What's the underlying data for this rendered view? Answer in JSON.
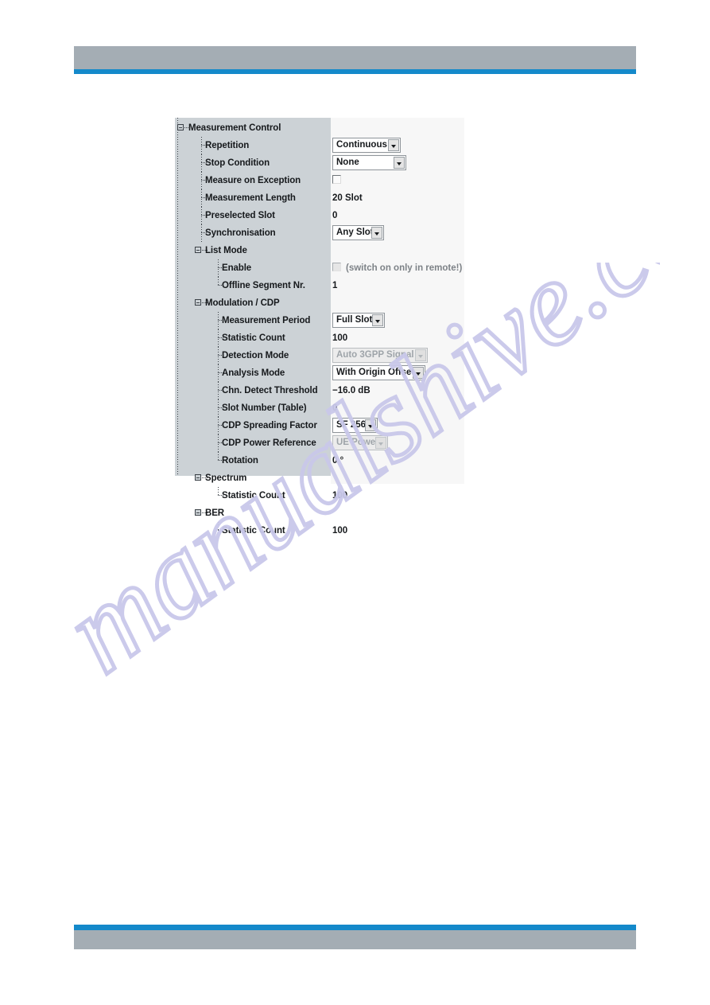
{
  "page": {
    "watermark_text": "manualshive.com",
    "accent_color": "#1489ca",
    "band_color": "#a4adb4",
    "tree_bg_color": "#ccd2d6",
    "value_bg_color": "#f7f7f7"
  },
  "dialog": {
    "title": "Measurement Control",
    "rows": [
      {
        "label": "Measurement Control",
        "depth": 0,
        "kind": "node",
        "expander": "collapse-box",
        "value_type": "none",
        "value": ""
      },
      {
        "label": "Repetition",
        "depth": 1,
        "kind": "leaf",
        "value_type": "combo",
        "value": "Continuous",
        "width": 86,
        "disabled": false
      },
      {
        "label": "Stop Condition",
        "depth": 1,
        "kind": "leaf",
        "value_type": "combo",
        "value": "None",
        "width": 93,
        "disabled": false
      },
      {
        "label": "Measure on Exception",
        "depth": 1,
        "kind": "leaf",
        "value_type": "checkbox",
        "value": "",
        "checked": false,
        "disabled": false
      },
      {
        "label": "Measurement Length",
        "depth": 1,
        "kind": "leaf",
        "value_type": "text",
        "value": "20 Slot"
      },
      {
        "label": "Preselected Slot",
        "depth": 1,
        "kind": "leaf",
        "value_type": "text",
        "value": "0"
      },
      {
        "label": "Synchronisation",
        "depth": 1,
        "kind": "leaf",
        "value_type": "combo",
        "value": "Any Slot",
        "width": 65,
        "disabled": false
      },
      {
        "label": "List Mode",
        "depth": 1,
        "kind": "node",
        "expander": "collapse-box",
        "value_type": "none",
        "value": ""
      },
      {
        "label": "Enable",
        "depth": 2,
        "kind": "leaf",
        "value_type": "checkbox-hint",
        "value": "",
        "hint": "(switch on only in remote!)",
        "checked": false,
        "disabled": true
      },
      {
        "label": "Offline Segment Nr.",
        "depth": 2,
        "kind": "leaf-last",
        "value_type": "text",
        "value": "1"
      },
      {
        "label": "Modulation / CDP",
        "depth": 1,
        "kind": "node",
        "expander": "collapse-box",
        "value_type": "none",
        "value": ""
      },
      {
        "label": "Measurement Period",
        "depth": 2,
        "kind": "leaf",
        "value_type": "combo",
        "value": "Full Slot",
        "width": 66,
        "disabled": false
      },
      {
        "label": "Statistic Count",
        "depth": 2,
        "kind": "leaf",
        "value_type": "text",
        "value": "100"
      },
      {
        "label": "Detection Mode",
        "depth": 2,
        "kind": "leaf",
        "value_type": "combo",
        "value": "Auto 3GPP Signal",
        "width": 120,
        "disabled": true
      },
      {
        "label": "Analysis Mode",
        "depth": 2,
        "kind": "leaf",
        "value_type": "combo",
        "value": "With Origin Offset",
        "width": 117,
        "disabled": false
      },
      {
        "label": "Chn. Detect Threshold",
        "depth": 2,
        "kind": "leaf",
        "value_type": "text",
        "value": "−16.0 dB"
      },
      {
        "label": "Slot Number (Table)",
        "depth": 2,
        "kind": "leaf",
        "value_type": "text",
        "value": "0"
      },
      {
        "label": "CDP Spreading Factor",
        "depth": 2,
        "kind": "leaf",
        "value_type": "combo",
        "value": "SF 256",
        "width": 57,
        "disabled": false
      },
      {
        "label": "CDP Power Reference",
        "depth": 2,
        "kind": "leaf",
        "value_type": "combo",
        "value": "UE Power",
        "width": 70,
        "disabled": true
      },
      {
        "label": "Rotation",
        "depth": 2,
        "kind": "leaf-last",
        "value_type": "text",
        "value": "0 °"
      },
      {
        "label": "Spectrum",
        "depth": 1,
        "kind": "node",
        "expander": "collapse-box",
        "value_type": "none",
        "value": ""
      },
      {
        "label": "Statistic Count",
        "depth": 2,
        "kind": "leaf-last",
        "value_type": "text",
        "value": "100"
      },
      {
        "label": "BER",
        "depth": 1,
        "kind": "node",
        "expander": "collapse-box",
        "value_type": "none",
        "value": ""
      },
      {
        "label": "Statistic Count",
        "depth": 2,
        "kind": "leaf-last",
        "value_type": "text",
        "value": "100"
      }
    ]
  }
}
